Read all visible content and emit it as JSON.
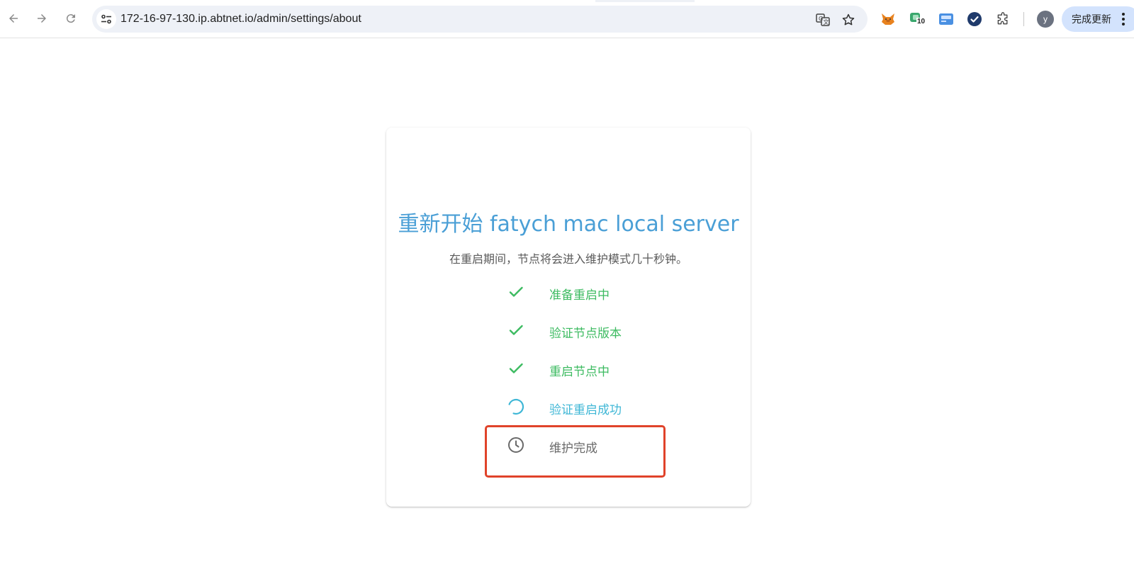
{
  "browser": {
    "url": "172-16-97-130.ip.abtnet.io/admin/settings/about",
    "profile_initial": "y",
    "update_button_label": "完成更新",
    "extension_badge_count": "10",
    "icons": {
      "back": "back-arrow-icon",
      "forward": "forward-arrow-icon",
      "reload": "reload-icon",
      "site_info": "tune-icon",
      "translate": "translate-icon",
      "bookmark": "star-icon",
      "ext_1": "fox-icon",
      "ext_2": "wallet-icon",
      "ext_3": "card-icon",
      "ext_4": "check-badge-icon",
      "extensions": "puzzle-icon",
      "menu": "more-vert-icon"
    }
  },
  "card": {
    "title": "重新开始 fatych mac local server",
    "subtitle": "在重启期间，节点将会进入维护模式几十秒钟。",
    "steps": [
      {
        "label": "准备重启中",
        "status": "done"
      },
      {
        "label": "验证节点版本",
        "status": "done"
      },
      {
        "label": "重启节点中",
        "status": "done"
      },
      {
        "label": "验证重启成功",
        "status": "in-progress"
      },
      {
        "label": "维护完成",
        "status": "pending"
      }
    ]
  },
  "colors": {
    "title": "#4a9fd6",
    "done": "#3dbb61",
    "in_progress": "#3fb7d6",
    "pending": "#6a6a6a",
    "highlight": "#e0432a"
  }
}
